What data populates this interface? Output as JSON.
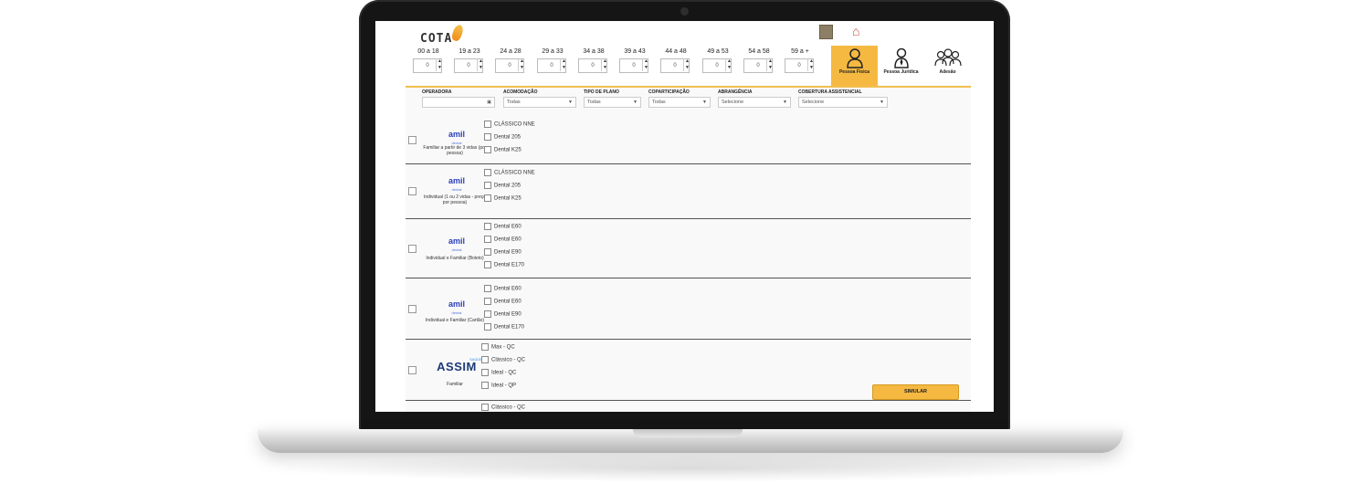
{
  "app": {
    "logo_text": "COTA",
    "ages": [
      {
        "label": "00 a 18",
        "value": "0"
      },
      {
        "label": "19 a 23",
        "value": "0"
      },
      {
        "label": "24 a 28",
        "value": "0"
      },
      {
        "label": "29 a 33",
        "value": "0"
      },
      {
        "label": "34 a 38",
        "value": "0"
      },
      {
        "label": "39 a 43",
        "value": "0"
      },
      {
        "label": "44 a 48",
        "value": "0"
      },
      {
        "label": "49 a 53",
        "value": "0"
      },
      {
        "label": "54 a 58",
        "value": "0"
      },
      {
        "label": "59 a +",
        "value": "0"
      }
    ],
    "profiles": [
      {
        "label": "Pessoa Física",
        "icon": "person-icon",
        "active": true
      },
      {
        "label": "Pessoa Jurídica",
        "icon": "business-person-icon",
        "active": false
      },
      {
        "label": "Adesão",
        "icon": "group-icon",
        "active": false
      }
    ],
    "filters": {
      "operadora": {
        "label": "OPERADORA",
        "value": ""
      },
      "acomodacao": {
        "label": "ACOMODAÇÃO",
        "value": "Todas"
      },
      "tipo_plano": {
        "label": "TIPO DE PLANO",
        "value": "Todas"
      },
      "coparticipacao": {
        "label": "COPARTICIPAÇÃO",
        "value": "Todas"
      },
      "abrangencia": {
        "label": "ABRANGÊNCIA",
        "value": "Selecione"
      },
      "cobertura": {
        "label": "COBERTURA ASSISTENCIAL",
        "value": "Selecione"
      }
    },
    "rows": [
      {
        "operator": "amil",
        "sub": "dental",
        "desc": "Familiar a partir de 3 vidas (por pessoa)",
        "plans": [
          "CLÁSSICO NNE",
          "Dental 205",
          "Dental K25"
        ]
      },
      {
        "operator": "amil",
        "sub": "dental",
        "desc": "Individual (1 ou 2 vidas - preço por pessoa)",
        "plans": [
          "CLÁSSICO NNE",
          "Dental 205",
          "Dental K25"
        ]
      },
      {
        "operator": "amil",
        "sub": "dental",
        "desc": "Individual e Familiar (Boleto)",
        "plans": [
          "Dental E60",
          "Dental E60",
          "Dental E90",
          "Dental E170"
        ]
      },
      {
        "operator": "amil",
        "sub": "dental",
        "desc": "Individual e Familiar (Cartão)",
        "plans": [
          "Dental E60",
          "Dental E60",
          "Dental E90",
          "Dental E170"
        ]
      },
      {
        "operator": "ASSIM",
        "sub": "SAÚDE",
        "desc": "Familiar",
        "plans": [
          "Max - QC",
          "Clássico - QC",
          "Ideal - QC",
          "Ideal - QP"
        ]
      }
    ],
    "simular_label": "SIMULAR",
    "partial_next_plan": "Clássico - QC"
  }
}
